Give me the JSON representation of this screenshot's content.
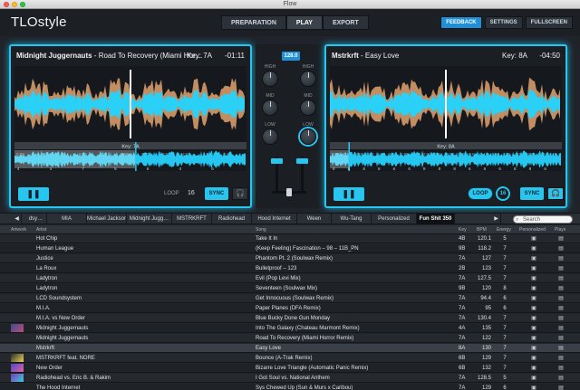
{
  "window": {
    "title": "Flow"
  },
  "app": {
    "logo": "TLOstyle"
  },
  "nav": {
    "tabs": [
      "PREPARATION",
      "PLAY",
      "EXPORT"
    ],
    "active": 1
  },
  "top_actions": [
    "FEEDBACK",
    "SETTINGS",
    "FULLSCREEN"
  ],
  "deck_left": {
    "artist": "Midnight Juggernauts",
    "title": "Road To Recovery (Miami Hor…",
    "key": "Key: 7A",
    "time": "-01:11",
    "key_label": "Key: 7A",
    "timeline": [
      "0:00",
      "0:30",
      "1:00",
      "1:30",
      "2:00",
      "2:30",
      "3:00",
      "3:30",
      "4:00",
      "4:30",
      "5:00"
    ],
    "cue_marks": [
      "4",
      "4",
      "7",
      "6",
      "6",
      "4",
      "6"
    ],
    "loop_label": "LOOP",
    "loop_value": "16",
    "sync_label": "SYNC",
    "play_glyph": "❚❚",
    "headphones_glyph": "🎧",
    "progress": 0.52
  },
  "deck_right": {
    "artist": "Mstrkrft",
    "title": "Easy Love",
    "key": "Key: 8A",
    "time": "-04:50",
    "key_label": "Key: 8A",
    "timeline": [
      "0:00",
      "0:15",
      "0:30",
      "0:45",
      "1:00",
      "1:15",
      "1:30",
      "1:45",
      "2:00",
      "2:15",
      "2:30",
      "2:45",
      "3:00",
      "3:15",
      "3:30",
      "3:45",
      "4:00",
      "4:15",
      "4:30",
      "4:45"
    ],
    "cue_marks": [
      "6",
      "6",
      "8",
      "8",
      "6",
      "6",
      "8",
      "8",
      "8",
      "6",
      "6",
      "6",
      "8",
      "8",
      "6"
    ],
    "loop_label": "LOOP",
    "loop_value": "16",
    "sync_label": "SYNC",
    "play_glyph": "❚❚",
    "headphones_glyph": "🎧",
    "progress": 0.08
  },
  "mixer": {
    "bpm": "128.0",
    "knob_labels": [
      "HIGH",
      "HIGH",
      "MID",
      "MID",
      "LOW",
      "LOW"
    ]
  },
  "playlists": {
    "arrow_left": "◀",
    "arrow_right": "▶",
    "items": [
      "dsy…",
      "MIA",
      "Michael Jackson",
      "Midnight Jugg…",
      "MSTRKRFT",
      "Radiohead",
      "Hood Internet",
      "Ween",
      "Wu-Tang",
      "Personalized",
      "Fun Shit 350"
    ],
    "active": 10,
    "search_placeholder": "Search"
  },
  "table": {
    "headers": {
      "artwork": "Artwork",
      "artist": "Artist",
      "song": "Song",
      "key": "Key",
      "bpm": "BPM",
      "energy": "Energy",
      "personalized": "Personalized",
      "plays": "Plays"
    },
    "rows": [
      {
        "artist": "Hot Chip",
        "song": "Take It In",
        "key": "4B",
        "bpm": "120.1",
        "energy": "5"
      },
      {
        "artist": "Human League",
        "song": "(Keep Feeling) Fascination – 98 – 11B_PN",
        "key": "9B",
        "bpm": "118.2",
        "energy": "7"
      },
      {
        "artist": "Justice",
        "song": "Phantom Pt. 2 (Soulwax Remix)",
        "key": "7A",
        "bpm": "127",
        "energy": "7"
      },
      {
        "artist": "La Roux",
        "song": "Bulletproof – 123",
        "key": "2B",
        "bpm": "123",
        "energy": "7"
      },
      {
        "artist": "Ladytron",
        "song": "Evil (Pop Levi Mix)",
        "key": "7A",
        "bpm": "127.5",
        "energy": "7"
      },
      {
        "artist": "Ladytron",
        "song": "Seventeen (Soulwax Mix)",
        "key": "9B",
        "bpm": "120",
        "energy": "8"
      },
      {
        "artist": "LCD Soundsystem",
        "song": "Get Innocuous (Soulwax Remix)",
        "key": "7A",
        "bpm": "94.4",
        "energy": "6"
      },
      {
        "artist": "M.I.A.",
        "song": "Paper Planes (DFA Remix)",
        "key": "7A",
        "bpm": "95",
        "energy": "6"
      },
      {
        "artist": "M.I.A. vs New Order",
        "song": "Blue Bucky Done Gun Monday",
        "key": "7A",
        "bpm": "130.4",
        "energy": "7"
      },
      {
        "artist": "Midnight Juggernauts",
        "song": "Into The Galaxy (Chateau Marmont Remix)",
        "key": "4A",
        "bpm": "135",
        "energy": "7"
      },
      {
        "artist": "Midnight Juggernauts",
        "song": "Road To Recovery (Miami Horror Remix)",
        "key": "7A",
        "bpm": "122",
        "energy": "7"
      },
      {
        "artist": "Mstrkrft",
        "song": "Easy Love",
        "key": "8A",
        "bpm": "130",
        "energy": "7"
      },
      {
        "artist": "MSTRKRFT feat. NORE",
        "song": "Bounce (A-Trak Remix)",
        "key": "6B",
        "bpm": "129",
        "energy": "7"
      },
      {
        "artist": "New Order",
        "song": "Bizarre Love Triangle (Automatic Panic Remix)",
        "key": "6B",
        "bpm": "132",
        "energy": "7"
      },
      {
        "artist": "Radiohead vs. Eric B. & Rakim",
        "song": "I Got Soul vs. National Anthem",
        "key": "7A",
        "bpm": "128.5",
        "energy": "5"
      },
      {
        "artist": "The Hood Internet",
        "song": "Sys Chewed Up (Sun & Murs x Caribou)",
        "key": "7A",
        "bpm": "129",
        "energy": "6"
      }
    ],
    "selected_row": 11,
    "personalized_glyph": "▣",
    "plays_glyph": "▤"
  },
  "colors": {
    "accent": "#28c6ef",
    "blue": "#1f8fd6",
    "wave_orange": "#e0a46f"
  }
}
